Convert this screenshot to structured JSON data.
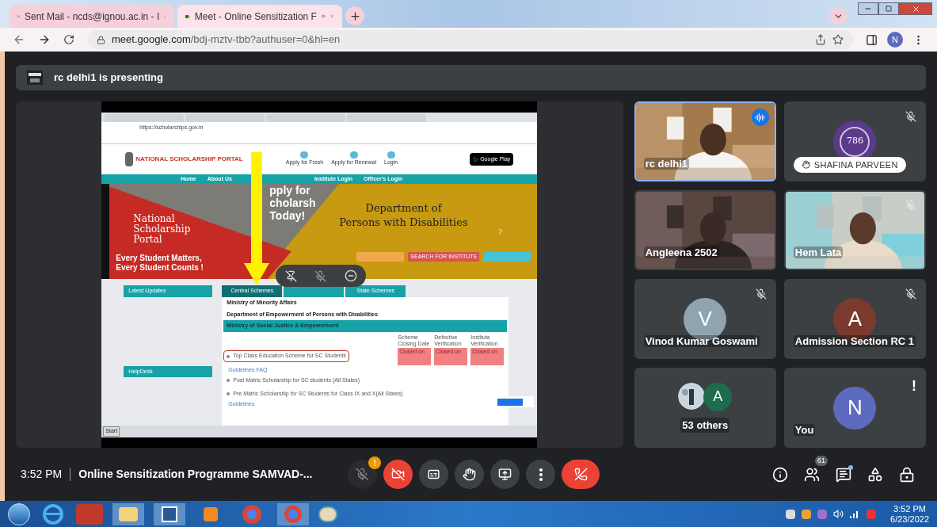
{
  "browser": {
    "tabs": [
      {
        "title": "Sent Mail - ncds@ignou.ac.in - I",
        "kind": "mail",
        "selected": false,
        "audio": false
      },
      {
        "title": "Meet - Online Sensitization F",
        "kind": "meet",
        "selected": true,
        "audio": true
      }
    ],
    "url_host": "meet.google.com",
    "url_path": "/bdj-mztv-tbb?authuser=0&hl=en",
    "profile": "N"
  },
  "presenting": "rc delhi1 is presenting",
  "shared_screen": {
    "browser_url": "https://scholarships.gov.in",
    "site_title": "NATIONAL SCHOLARSHIP PORTAL",
    "header_links": [
      "Apply for Fresh",
      "Apply for Renewal",
      "Login"
    ],
    "store_badge": "Google Play",
    "nav": [
      "Home",
      "About Us",
      "Institute Login",
      "Officer's Login"
    ],
    "banner_apply": [
      "pply for",
      "cholarsh",
      "Today!"
    ],
    "banner_brand": [
      "National",
      "Scholarship",
      "Portal"
    ],
    "slogan": [
      "Every Student Matters,",
      "Every Student Counts !"
    ],
    "banner_right": [
      "Department of",
      "Persons with Disabilities"
    ],
    "banner_buttons": [
      {
        "color": "#f0a94a"
      },
      {
        "label": "SEARCH FOR INSTITUTE",
        "color": "#d9534f"
      },
      {
        "color": "#46c3d6"
      }
    ],
    "latest_updates": "Latest Updates",
    "helpdesk": "HelpDesk",
    "scheme_tabs": [
      {
        "label": "Central Schemes",
        "selected": true
      },
      {
        "selected": false
      },
      {
        "label": "State Schemes",
        "selected": false
      }
    ],
    "ministries": [
      {
        "label": "Ministry of Minority Affairs",
        "expanded": false
      },
      {
        "label": "Department of Empowerment of Persons with Disabilities",
        "expanded": false
      },
      {
        "label": "Ministry of Social Justice & Empowerment",
        "expanded": true
      }
    ],
    "columns": [
      "Scheme Closing Date",
      "Defective Verification",
      "Institute Verification"
    ],
    "schemes": [
      {
        "name": "Top Class Education Scheme for SC Students",
        "highlighted": true,
        "cells": [
          "Closed on",
          "Closed on",
          "Closed on"
        ],
        "links": "Guidelines FAQ"
      },
      {
        "name": "Post Matric Scholarship for SC students (All States)",
        "highlighted": false
      },
      {
        "name": "Pre Matric Scholarship for SC Students for Class IX and X(All States)",
        "highlighted": false,
        "links": "Guidelines"
      }
    ],
    "start_button": "Start"
  },
  "participants": [
    {
      "name": "rc delhi1",
      "kind": "video",
      "speaking": true,
      "muted": false,
      "hand_raised": false
    },
    {
      "name": "SHAFINA PARVEEN",
      "kind": "avatar",
      "avatar_text": "786",
      "color": "#5b3a8c",
      "speaking": false,
      "muted": true,
      "hand_raised": true
    },
    {
      "name": "Angleena 2502",
      "kind": "video",
      "speaking": false,
      "muted": false,
      "hand_raised": false
    },
    {
      "name": "Hem Lata",
      "kind": "video",
      "speaking": false,
      "muted": true,
      "hand_raised": false
    },
    {
      "name": "Vinod Kumar Goswami",
      "kind": "avatar",
      "avatar_text": "V",
      "color": "#8fa4b0",
      "speaking": false,
      "muted": true,
      "hand_raised": false
    },
    {
      "name": "Admission Section RC 1",
      "kind": "avatar",
      "avatar_text": "A",
      "color": "#7a3b2e",
      "speaking": false,
      "muted": true,
      "hand_raised": false
    },
    {
      "name": "53 others",
      "kind": "others",
      "avatar_text": "A",
      "color": "#1e6b4e",
      "speaking": false,
      "muted": false,
      "hand_raised": false
    },
    {
      "name": "You",
      "kind": "avatar",
      "avatar_text": "N",
      "color": "#5c6bc0",
      "speaking": false,
      "muted": false,
      "hand_raised": false,
      "alert": "!"
    }
  ],
  "bottom_bar": {
    "time": "3:52 PM",
    "meeting_title": "Online Sensitization Programme SAMVAD-...",
    "controls": [
      {
        "kind": "mic",
        "on": false,
        "badge": "!"
      },
      {
        "kind": "camera",
        "on": false
      },
      {
        "kind": "captions",
        "on": false
      },
      {
        "kind": "hand",
        "on": false
      },
      {
        "kind": "present",
        "on": false
      },
      {
        "kind": "more"
      },
      {
        "kind": "leave"
      }
    ],
    "people_count": "61",
    "chat_unread": true
  },
  "taskbar": {
    "time": "3:52 PM",
    "date": "6/23/2022"
  }
}
